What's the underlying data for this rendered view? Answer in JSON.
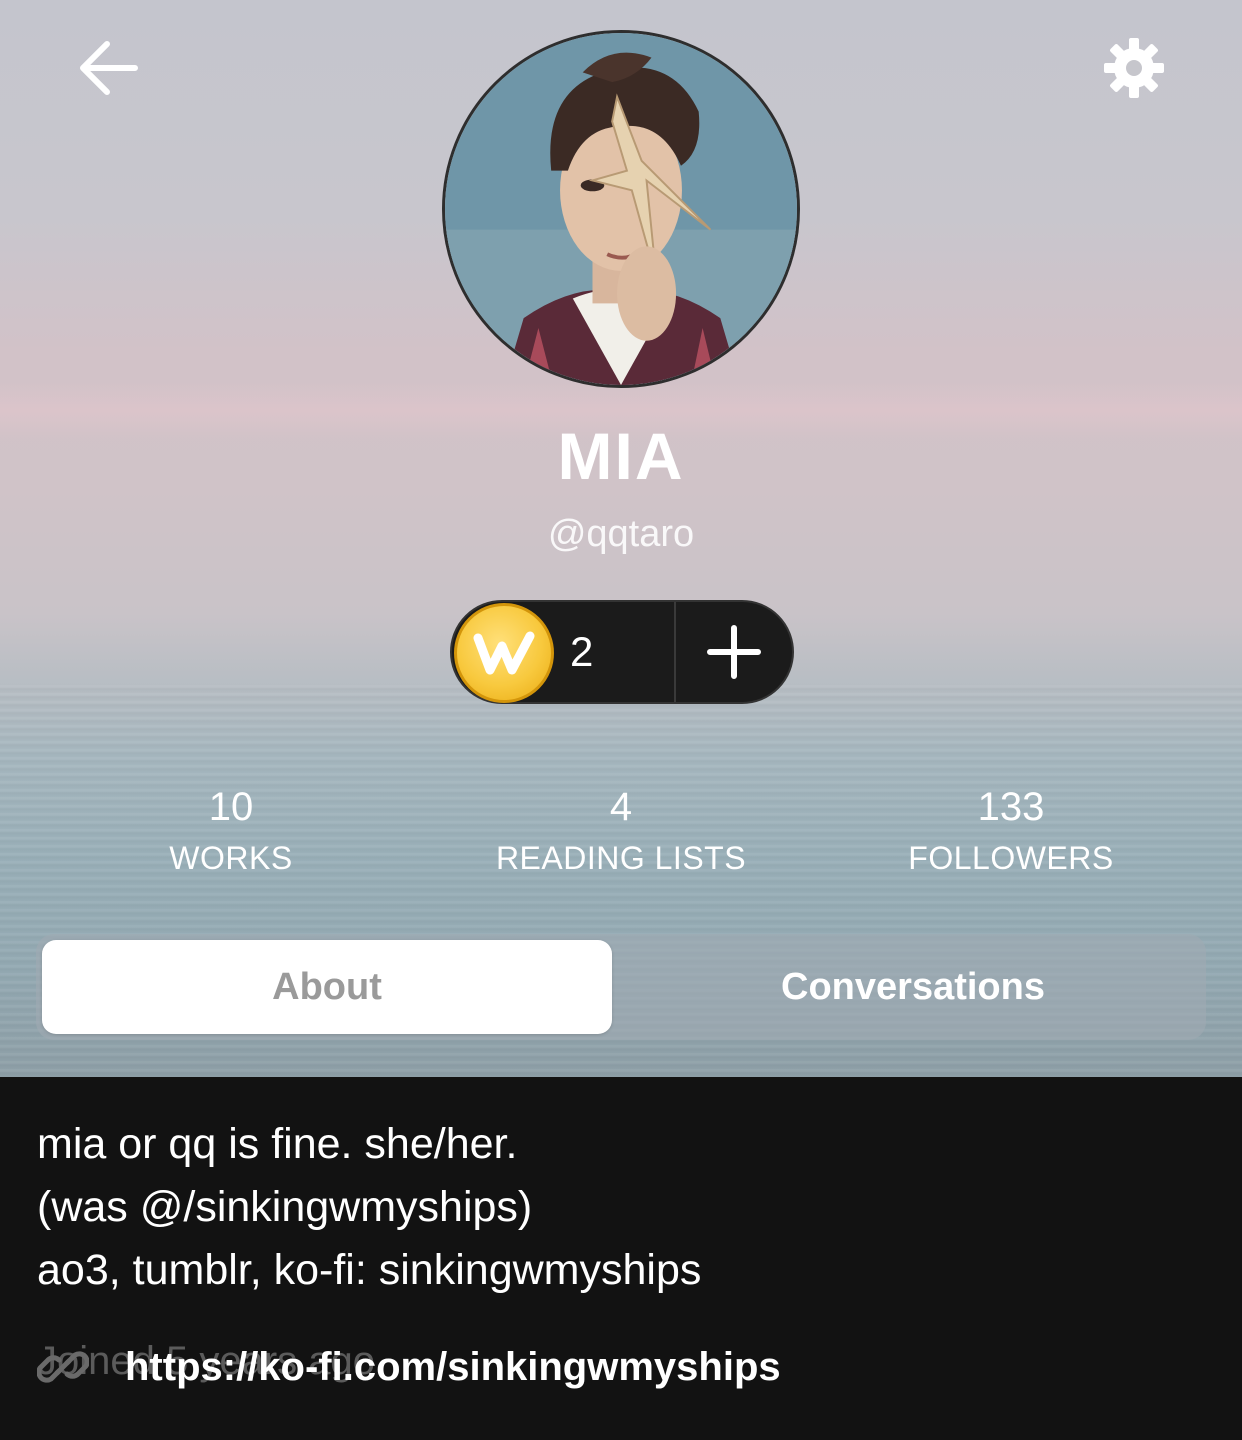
{
  "header": {
    "back_icon": "arrow-left-icon",
    "settings_icon": "gear-icon"
  },
  "profile": {
    "display_name": "MIA",
    "username": "@qqtaro",
    "coins": {
      "count": "2",
      "coin_icon": "wattpad-coin-icon",
      "add_icon": "plus-icon"
    }
  },
  "stats": [
    {
      "value": "10",
      "label": "WORKS"
    },
    {
      "value": "4",
      "label": "READING LISTS"
    },
    {
      "value": "133",
      "label": "FOLLOWERS"
    }
  ],
  "tabs": [
    {
      "label": "About",
      "active": true
    },
    {
      "label": "Conversations",
      "active": false
    }
  ],
  "about": {
    "bio_lines": [
      "mia or qq is fine. she/her.",
      "(was @/sinkingwmyships)",
      "ao3, tumblr, ko-fi: sinkingwmyships"
    ],
    "joined": "Joined 5 years ago",
    "link": "https://ko-fi.com/sinkingwmyships",
    "link_icon": "link-icon"
  },
  "colors": {
    "coin_gold": "#f8c93e",
    "pill_dark": "#1b1b1b",
    "about_bg": "#121212"
  }
}
